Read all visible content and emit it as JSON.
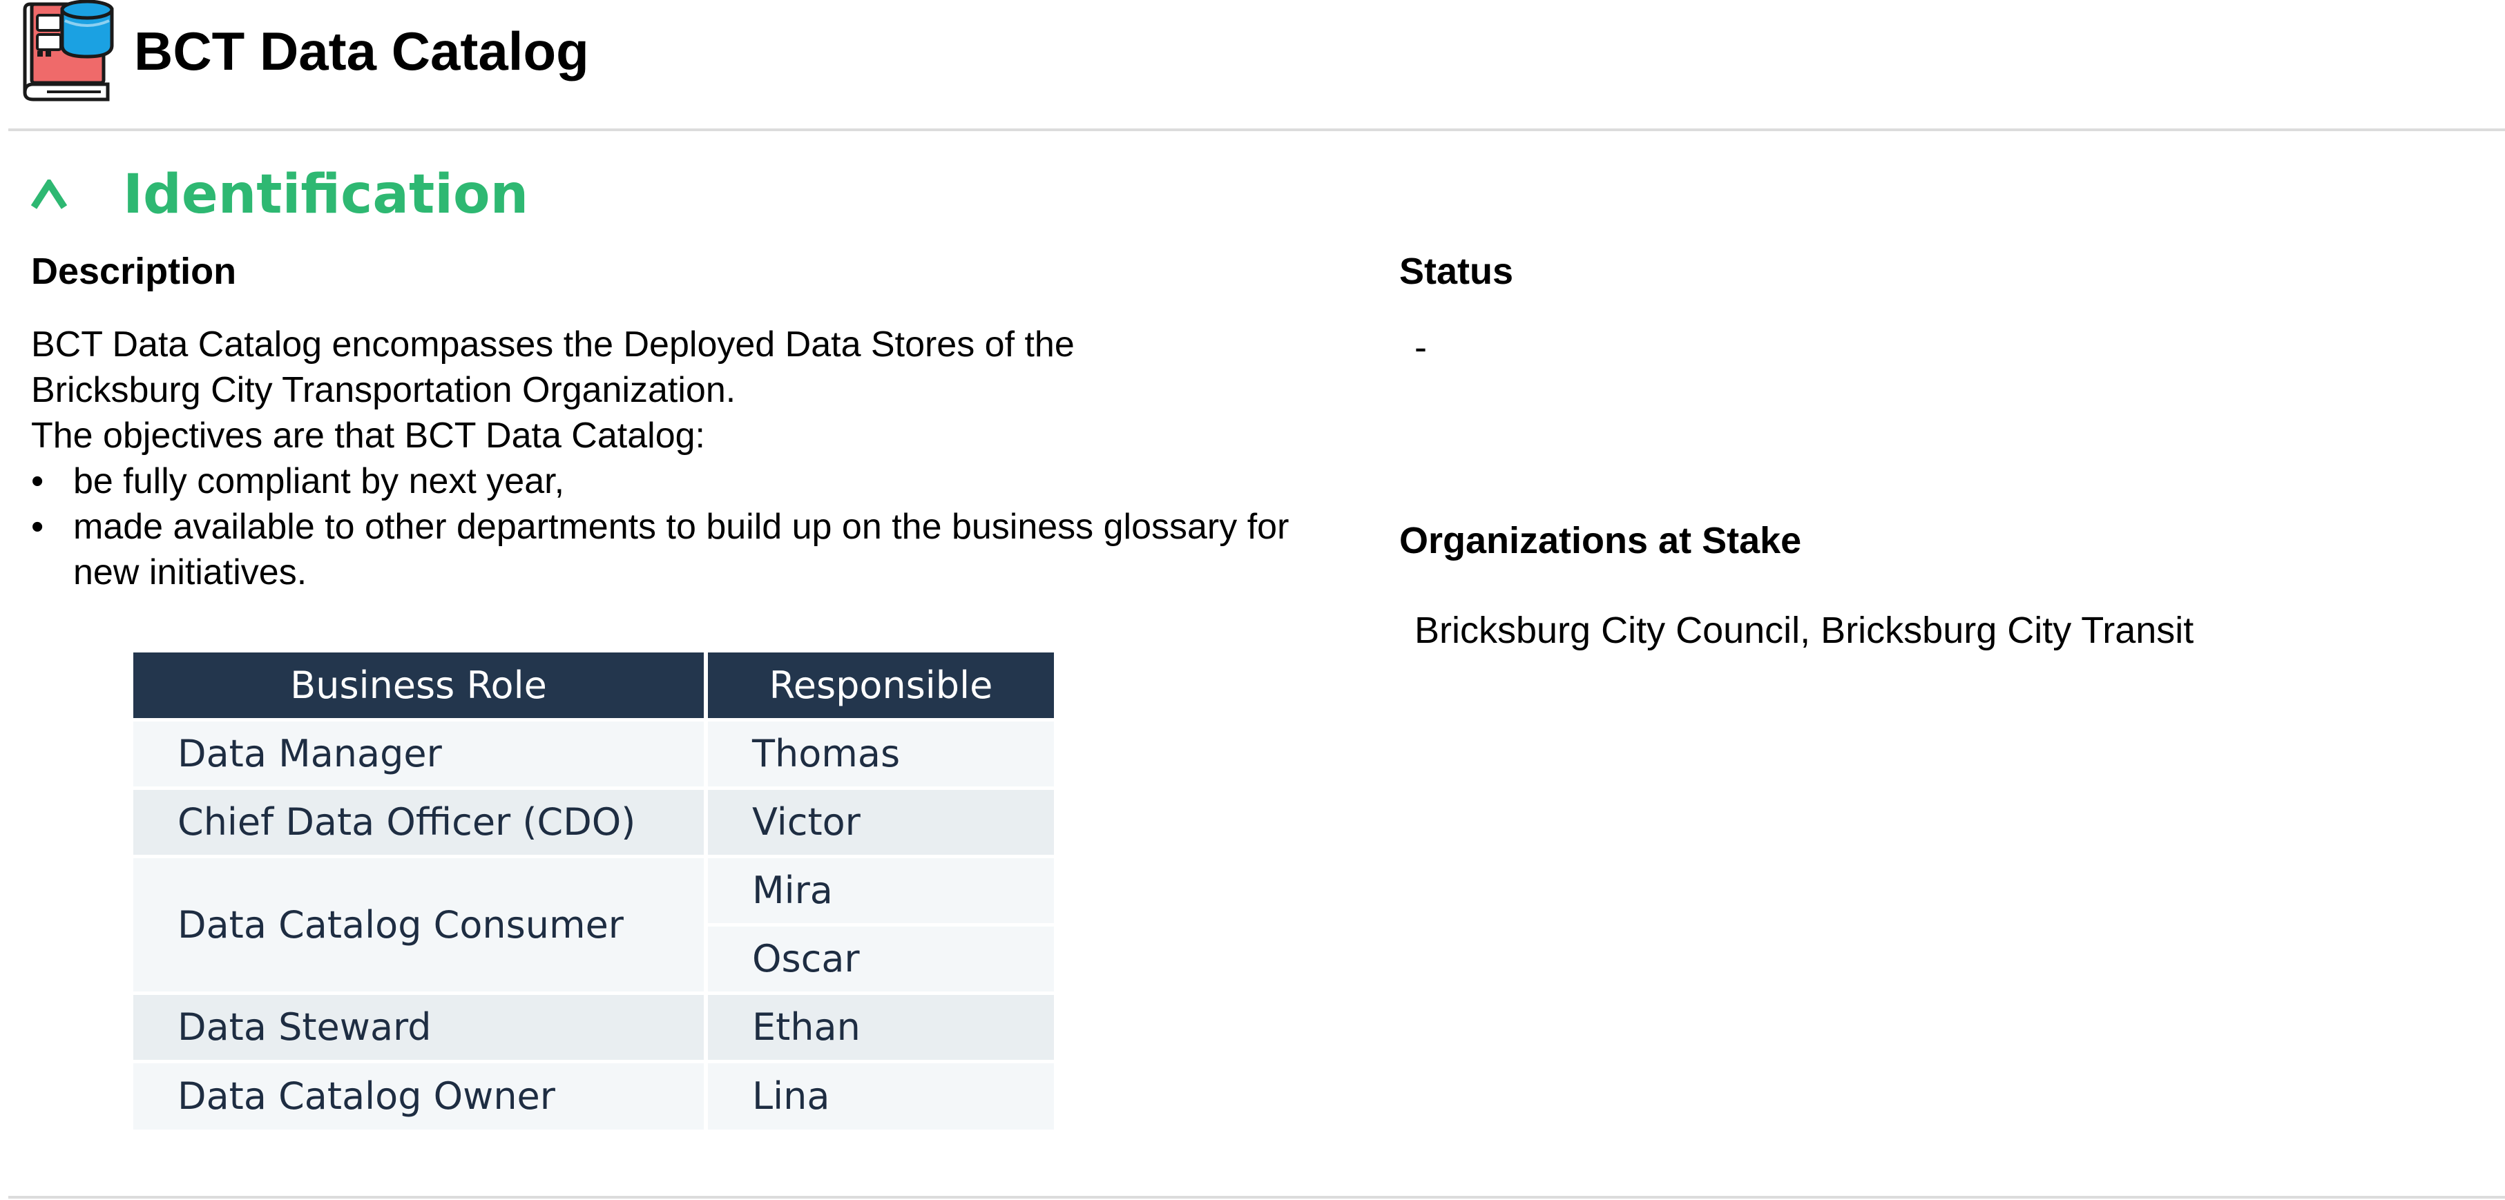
{
  "app": {
    "title": "BCT Data Catalog",
    "logo_icon": "data-catalog-book-icon",
    "accent_color": "#2eb872",
    "table_header_color": "#23364d"
  },
  "section": {
    "toggle_icon": "chevron-up-icon",
    "toggle_glyph": "∧",
    "title": "Identification"
  },
  "description": {
    "label": "Description",
    "lines": [
      "BCT Data Catalog encompasses the Deployed Data Stores of the",
      "Bricksburg City Transportation Organization.",
      "The objectives are that BCT Data Catalog:"
    ],
    "bullets": [
      "be fully compliant by next year,",
      "made available to other departments to build up on the business glossary for new initiatives."
    ]
  },
  "status": {
    "label": "Status",
    "value": "-"
  },
  "organizations": {
    "label": "Organizations at Stake",
    "value": "Bricksburg City Council, Bricksburg City Transit"
  },
  "roles_table": {
    "headers": [
      "Business Role",
      "Responsible"
    ],
    "rows": [
      {
        "role": "Data Manager",
        "responsible": [
          "Thomas"
        ]
      },
      {
        "role": "Chief Data Officer (CDO)",
        "responsible": [
          "Victor"
        ]
      },
      {
        "role": "Data Catalog Consumer",
        "responsible": [
          "Mira",
          "Oscar"
        ]
      },
      {
        "role": "Data Steward",
        "responsible": [
          "Ethan"
        ]
      },
      {
        "role": "Data Catalog Owner",
        "responsible": [
          "Lina"
        ]
      }
    ]
  }
}
